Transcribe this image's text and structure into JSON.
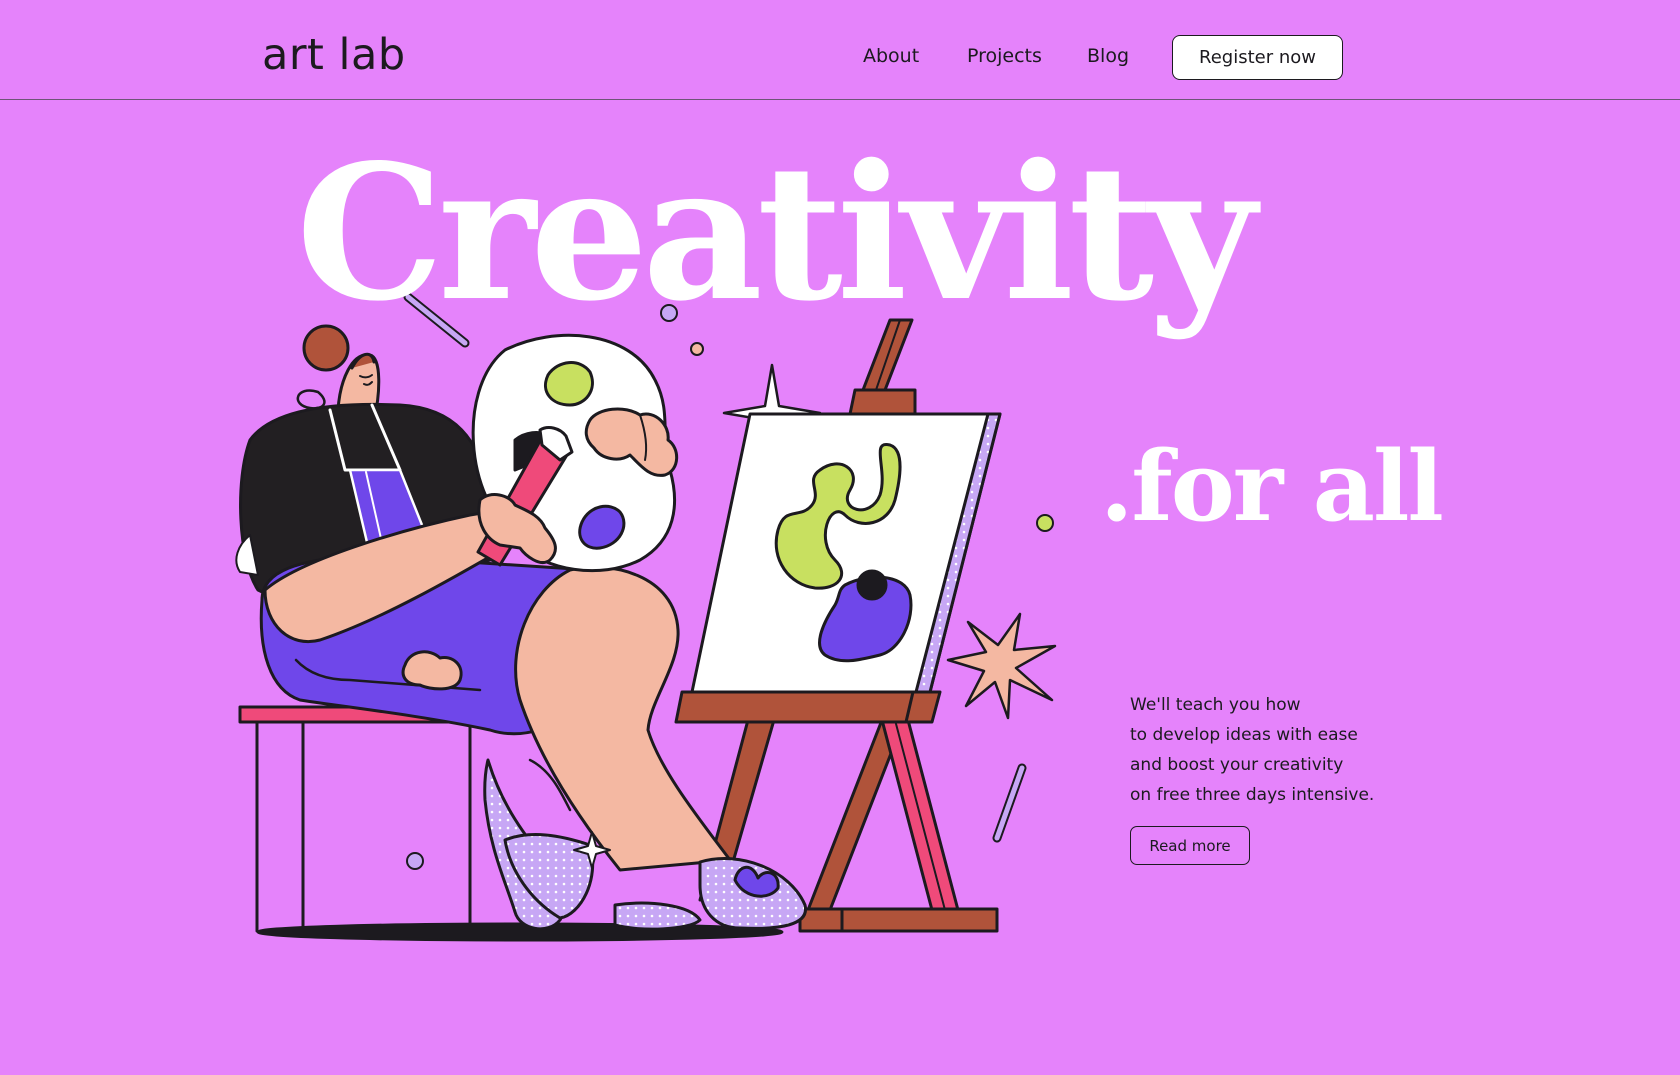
{
  "header": {
    "logo": "art lab",
    "nav": {
      "about": "About",
      "projects": "Projects",
      "blog": "Blog"
    },
    "register_label": "Register now"
  },
  "hero": {
    "headline": "Creativity",
    "subheadline": ".for all",
    "description_lines": [
      "We'll teach you how",
      "to develop ideas with ease",
      "and boost your creativity",
      "on free three days intensive."
    ],
    "read_more_label": "Read more"
  },
  "colors": {
    "background": "#e583fb",
    "ink": "#1c1a1f",
    "white": "#ffffff",
    "purple": "#6f47ea",
    "lime": "#c8e060",
    "skin": "#f4b8a2",
    "pink_red": "#ef4a7a",
    "wood": "#b0533a",
    "lavender": "#c7a7f5"
  },
  "icons": {
    "sparkle": "sparkle-icon",
    "starburst": "starburst-icon"
  }
}
